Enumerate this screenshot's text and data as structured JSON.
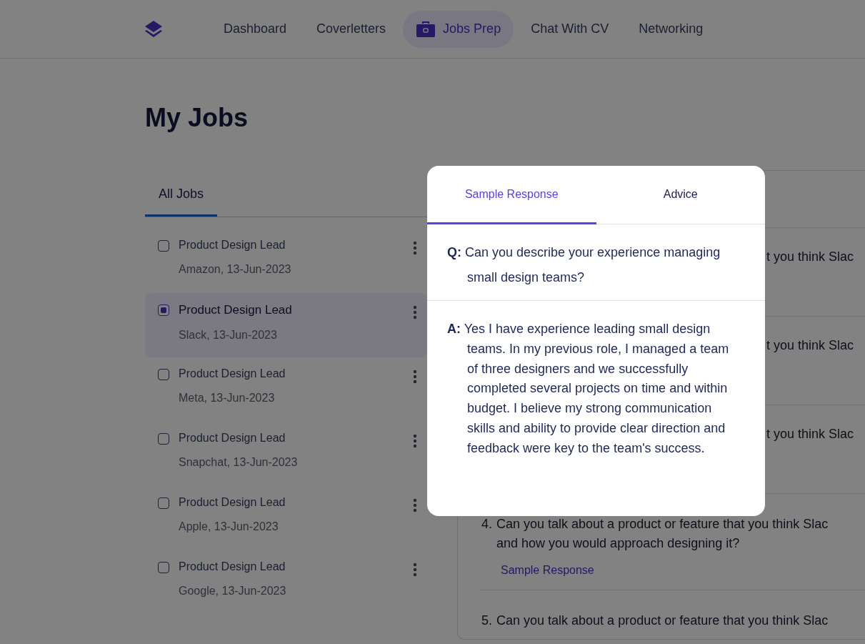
{
  "nav": {
    "items": [
      {
        "label": "Dashboard",
        "selected": false
      },
      {
        "label": "Coverletters",
        "selected": false
      },
      {
        "label": "Jobs Prep",
        "selected": true
      },
      {
        "label": "Chat With CV",
        "selected": false
      },
      {
        "label": "Networking",
        "selected": false
      }
    ]
  },
  "page_title": "My Jobs",
  "job_tabs": [
    {
      "label": "All Jobs",
      "selected": true
    }
  ],
  "jobs": [
    {
      "title": "Product Design Lead",
      "subtitle": "Amazon, 13-Jun-2023",
      "checked": false,
      "selected": false
    },
    {
      "title": "Product Design Lead",
      "subtitle": "Slack, 13-Jun-2023",
      "checked": true,
      "selected": true
    },
    {
      "title": "Product Design Lead",
      "subtitle": "Meta, 13-Jun-2023",
      "checked": false,
      "selected": false
    },
    {
      "title": "Product Design Lead",
      "subtitle": "Snapchat, 13-Jun-2023",
      "checked": false,
      "selected": false
    },
    {
      "title": "Product Design Lead",
      "subtitle": "Apple, 13-Jun-2023",
      "checked": false,
      "selected": false
    },
    {
      "title": "Product Design Lead",
      "subtitle": "Google, 13-Jun-2023",
      "checked": false,
      "selected": false
    }
  ],
  "questions": [
    {
      "kind": "covered",
      "lines": [
        "t you think Slac"
      ]
    },
    {
      "kind": "covered",
      "lines": [
        "t you think Slac"
      ]
    },
    {
      "kind": "covered",
      "lines": [
        "t you think Slac"
      ]
    },
    {
      "kind": "full",
      "number": "4.",
      "lines": [
        "Can you talk about a product or feature that you think Slac",
        "and how you would approach designing it?"
      ],
      "link": "Sample Response"
    },
    {
      "kind": "full",
      "number": "5.",
      "lines": [
        "Can you talk about a product or feature that you think Slac"
      ]
    }
  ],
  "modal": {
    "tabs": [
      {
        "label": "Sample Response",
        "selected": true
      },
      {
        "label": "Advice",
        "selected": false
      }
    ],
    "question": "**Q:** Can you describe your experience managing small design teams?",
    "answer": "**A:** Yes I have experience leading small design teams. In my previous role, I managed a team of three designers and we successfully completed several projects on time and within budget. I believe my strong communication skills and ability to provide clear direction and feedback were key to the team's success."
  }
}
